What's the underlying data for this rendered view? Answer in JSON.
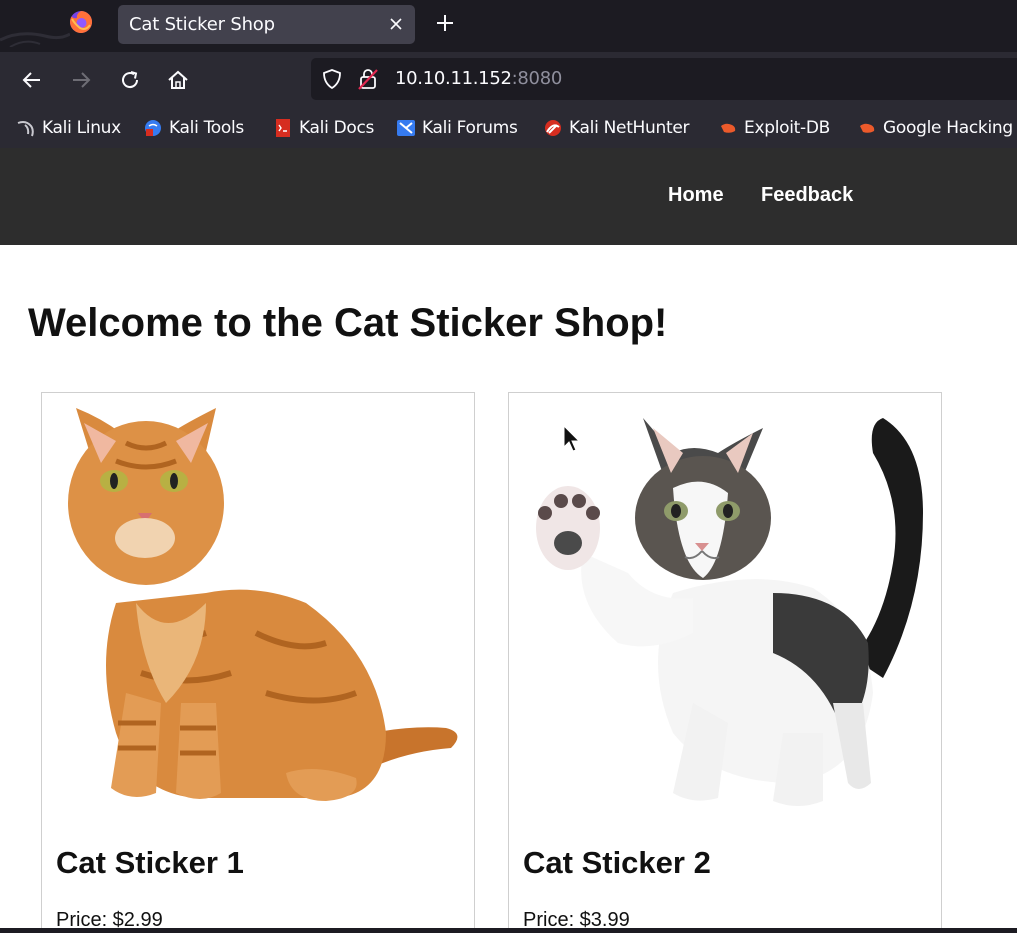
{
  "browser": {
    "tab_title": "Cat Sticker Shop",
    "url_host": "10.10.11.152",
    "url_port": ":8080",
    "icons": {
      "close": "close-icon",
      "new_tab": "plus-icon",
      "back": "back-arrow-icon",
      "forward": "forward-arrow-icon",
      "reload": "reload-icon",
      "home": "home-icon",
      "shield": "shield-icon",
      "lock": "lock-insecure-icon"
    },
    "bookmarks": [
      {
        "label": "Kali Linux",
        "icon": "kali-dragon-icon",
        "color": "#c9c9d0"
      },
      {
        "label": "Kali Tools",
        "icon": "kali-tools-icon",
        "color": "#367bf0"
      },
      {
        "label": "Kali Docs",
        "icon": "kali-docs-icon",
        "color": "#d62d20"
      },
      {
        "label": "Kali Forums",
        "icon": "kali-forums-icon",
        "color": "#367bf0"
      },
      {
        "label": "Kali NetHunter",
        "icon": "nethunter-icon",
        "color": "#d62d20"
      },
      {
        "label": "Exploit-DB",
        "icon": "exploit-db-icon",
        "color": "#ec5a2b"
      },
      {
        "label": "Google Hacking",
        "icon": "google-hacking-icon",
        "color": "#ec5a2b"
      }
    ]
  },
  "site": {
    "nav": [
      {
        "label": "Home"
      },
      {
        "label": "Feedback"
      }
    ],
    "heading": "Welcome to the Cat Sticker Shop!",
    "products": [
      {
        "title": "Cat Sticker 1",
        "price": "Price: $2.99",
        "image": "orange-tabby-cat-image"
      },
      {
        "title": "Cat Sticker 2",
        "price": "Price: $3.99",
        "image": "calico-kitten-image"
      }
    ]
  },
  "colors": {
    "chrome_dark": "#1c1b22",
    "chrome": "#2b2a33",
    "tab_active": "#42414d",
    "site_header": "#2d2d2d",
    "firefox_orange": "#ff7139"
  }
}
